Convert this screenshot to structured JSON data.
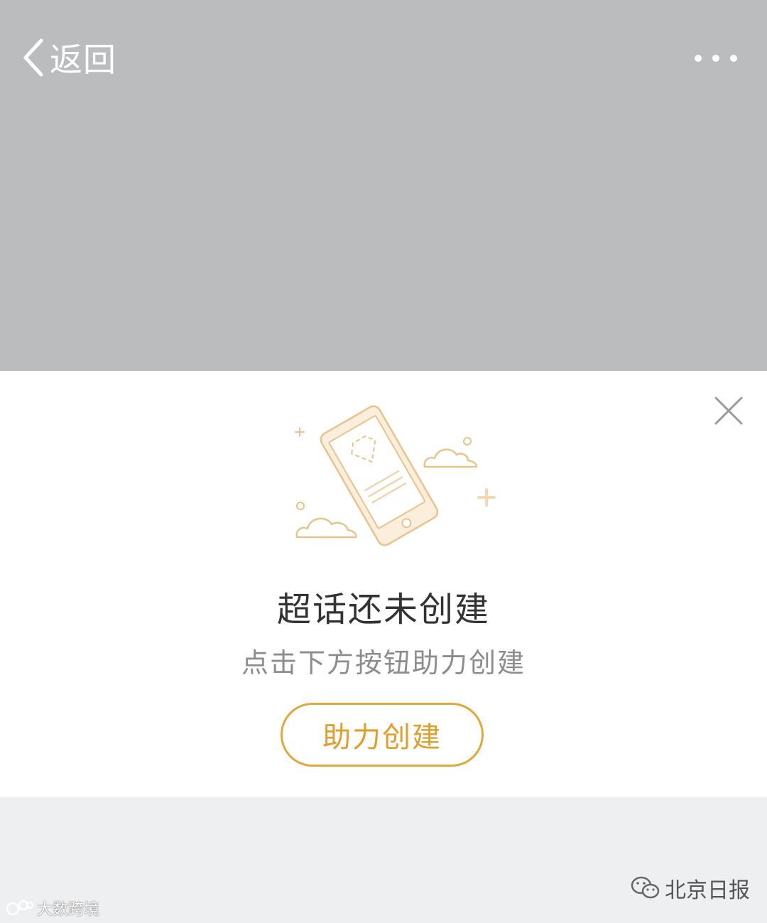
{
  "nav": {
    "back_label": "返回"
  },
  "empty_state": {
    "title": "超话还未创建",
    "subtitle": "点击下方按钮助力创建",
    "button_label": "助力创建"
  },
  "watermarks": {
    "left": "大数跨境",
    "right": "北京日报"
  },
  "colors": {
    "header_bg": "#bbbcbe",
    "accent": "#e3a83b",
    "illustration_stroke": "#e8c48a",
    "illustration_fill": "#fbeedd"
  }
}
